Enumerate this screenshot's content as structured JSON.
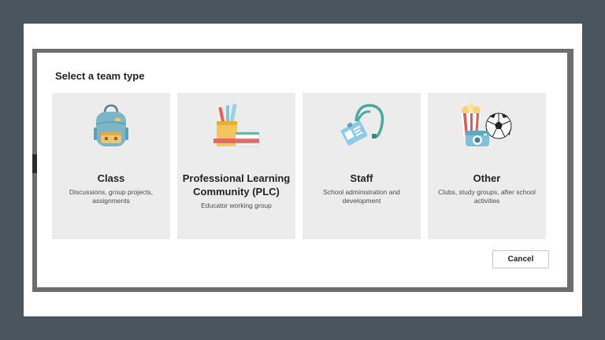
{
  "dialog": {
    "title": "Select a team type",
    "cancel_label": "Cancel"
  },
  "cards": [
    {
      "title": "Class",
      "description": "Discussions, group projects, assignments",
      "icon": "backpack-icon"
    },
    {
      "title": "Professional Learning Community (PLC)",
      "description": "Educator working group",
      "icon": "books-pencils-icon"
    },
    {
      "title": "Staff",
      "description": "School administration and development",
      "icon": "id-badge-lanyard-icon"
    },
    {
      "title": "Other",
      "description": "Clubs, study groups, after school activities",
      "icon": "popcorn-soccer-camera-icon"
    }
  ],
  "colors": {
    "backdrop": "#4a555e",
    "card_bg": "#ececec",
    "text": "#252424"
  }
}
